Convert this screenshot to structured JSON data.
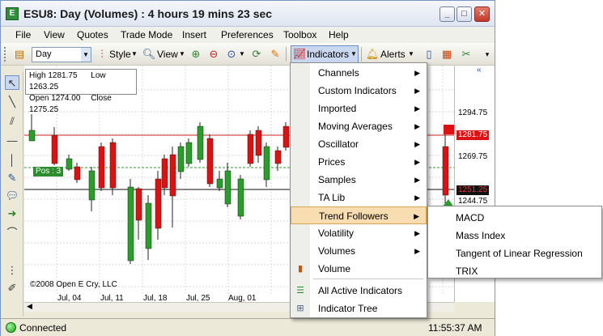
{
  "window": {
    "title": "ESU8: Day (Volumes) : 4 hours 19 mins 23 sec",
    "app_icon_glyph": "E",
    "buttons": {
      "minimize": "_",
      "maximize": "□",
      "close": "✕"
    }
  },
  "menubar": [
    "File",
    "View",
    "Quotes",
    "Trade Mode",
    "Insert",
    "Preferences",
    "Toolbox",
    "Help"
  ],
  "toolbar": {
    "period_value": "Day",
    "style_label": "Style",
    "view_label": "View",
    "indicators_label": "Indicators",
    "alerts_label": "Alerts",
    "icons": [
      "period-icon",
      "style-icon",
      "view-icon",
      "zoom-in-icon",
      "zoom-out-icon",
      "zoom-menu-icon",
      "refresh-icon",
      "indicators-toggle-icon",
      "alerts-icon"
    ]
  },
  "info_box": {
    "high_label": "High",
    "high": "1281.75",
    "low_label": "Low",
    "low": "1263.25",
    "open_label": "Open",
    "open": "1274.00",
    "close_label": "Close",
    "close": "1275.25"
  },
  "chart": {
    "position_tag": "Pos : 3",
    "copyright": "©2008 Open E Cry, LLC",
    "date_labels": [
      "Jul, 04",
      "Jul, 11",
      "Jul, 18",
      "Jul, 25",
      "Aug, 01"
    ],
    "price_labels": [
      "1294.75",
      "1269.75",
      "1244.75"
    ],
    "price_badges": {
      "red_line": "1281.75",
      "current": "1251.25"
    },
    "colors": {
      "up": "#2a9d2a",
      "down": "#dd1111",
      "red_line": "#cc2020",
      "green_line": "#2a9d2a"
    }
  },
  "chart_data": {
    "type": "candlestick",
    "candles": [
      {
        "dir": "up"
      },
      {
        "dir": "down"
      },
      {
        "dir": "up"
      },
      {
        "dir": "down"
      },
      {
        "dir": "up"
      },
      {
        "dir": "down"
      },
      {
        "dir": "down"
      },
      {
        "dir": "up"
      },
      {
        "dir": "down"
      },
      {
        "dir": "up"
      },
      {
        "dir": "down"
      },
      {
        "dir": "down"
      },
      {
        "dir": "down"
      },
      {
        "dir": "up"
      },
      {
        "dir": "up"
      },
      {
        "dir": "up"
      },
      {
        "dir": "down"
      },
      {
        "dir": "up"
      },
      {
        "dir": "up"
      },
      {
        "dir": "up"
      },
      {
        "dir": "down"
      },
      {
        "dir": "down"
      },
      {
        "dir": "up"
      },
      {
        "dir": "down"
      },
      {
        "dir": "down"
      },
      {
        "dir": "up"
      },
      {
        "dir": "up"
      },
      {
        "dir": "down"
      },
      {
        "dir": "up"
      },
      {
        "dir": "down"
      },
      {
        "dir": "up"
      },
      {
        "dir": "down"
      },
      {
        "dir": "up"
      },
      {
        "dir": "up"
      },
      {
        "dir": "down"
      },
      {
        "dir": "up"
      }
    ]
  },
  "indicators_menu": {
    "items": [
      {
        "label": "Channels",
        "submenu": true
      },
      {
        "label": "Custom Indicators",
        "submenu": true
      },
      {
        "label": "Imported",
        "submenu": true
      },
      {
        "label": "Moving Averages",
        "submenu": true
      },
      {
        "label": "Oscillator",
        "submenu": true
      },
      {
        "label": "Prices",
        "submenu": true
      },
      {
        "label": "Samples",
        "submenu": true
      },
      {
        "label": "TA Lib",
        "submenu": true
      },
      {
        "label": "Trend Followers",
        "submenu": true,
        "highlighted": true
      },
      {
        "label": "Volatility",
        "submenu": true
      },
      {
        "label": "Volumes",
        "submenu": true
      },
      {
        "label": "Volume",
        "submenu": false,
        "icon": "volume-bars-icon"
      },
      {
        "label": "All Active Indicators",
        "submenu": false,
        "icon": "list-icon"
      },
      {
        "label": "Indicator Tree",
        "submenu": false,
        "icon": "tree-icon"
      }
    ],
    "submenu_arrow": "▶"
  },
  "trend_followers_submenu": [
    "MACD",
    "Mass Index",
    "Tangent of Linear Regression",
    "TRIX"
  ],
  "status": {
    "connection": "Connected",
    "time": "11:55:37 AM"
  }
}
